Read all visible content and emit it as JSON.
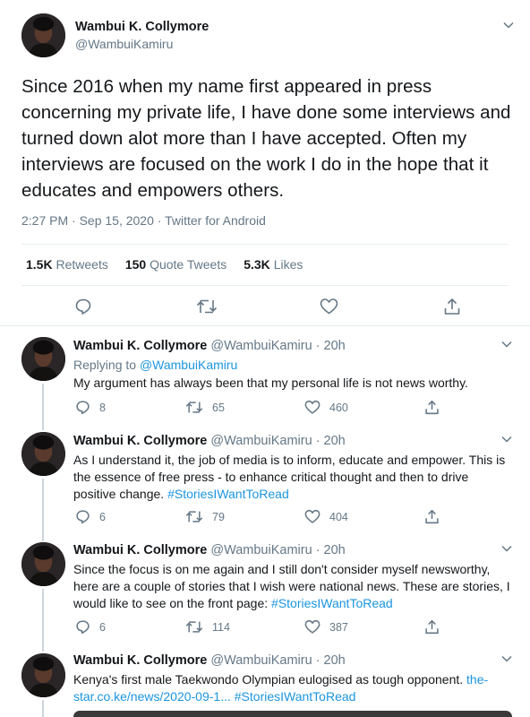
{
  "main_tweet": {
    "name": "Wambui K. Collymore",
    "handle": "@WambuiKamiru",
    "text": "Since 2016 when my name first appeared in press concerning my private life, I have done some interviews and turned down alot more than I have accepted. Often my interviews are focused on the work I do in the hope that it educates and empowers others.",
    "time": "2:27 PM · Sep 15, 2020",
    "source_sep": " · ",
    "source": "Twitter for Android",
    "retweets_count": "1.5K",
    "retweets_label": "Retweets",
    "quotes_count": "150",
    "quotes_label": "Quote Tweets",
    "likes_count": "5.3K",
    "likes_label": "Likes"
  },
  "replies": [
    {
      "name": "Wambui K. Collymore",
      "handle_time": "@WambuiKamiru · 20h",
      "replying_prefix": "Replying to ",
      "replying_to": "@WambuiKamiru",
      "text": "My argument has always been that my personal life is not news worthy.",
      "reply_count": "8",
      "retweet_count": "65",
      "like_count": "460"
    },
    {
      "name": "Wambui K. Collymore",
      "handle_time": "@WambuiKamiru · 20h",
      "text": "As I understand it, the job of media is to inform, educate and empower. This is the essence of free press - to enhance critical thought and then to drive positive change. ",
      "hashtag": "#StoriesIWantToRead",
      "reply_count": "6",
      "retweet_count": "79",
      "like_count": "404"
    },
    {
      "name": "Wambui K. Collymore",
      "handle_time": "@WambuiKamiru · 20h",
      "text": "Since the focus is on me again and I still don't consider myself newsworthy, here are a couple of stories that I wish were national news. These are stories, I would like to see on the front page: ",
      "hashtag": "#StoriesIWantToRead",
      "reply_count": "6",
      "retweet_count": "114",
      "like_count": "387"
    },
    {
      "name": "Wambui K. Collymore",
      "handle_time": "@WambuiKamiru · 20h",
      "text": "Kenya's first male Taekwondo Olympian eulogised as tough opponent. ",
      "link": "the-star.co.ke/news/2020-09-1...",
      "hashtag": "#StoriesIWantToRead"
    }
  ],
  "icons": {
    "reply": "reply-icon",
    "retweet": "retweet-icon",
    "like": "heart-icon",
    "share": "share-icon",
    "more": "chevron-down-icon"
  },
  "colors": {
    "text": "#14171a",
    "secondary": "#657786",
    "link": "#1b95e0",
    "border": "#e6ecf0",
    "thread_line": "#ccd6dd"
  }
}
